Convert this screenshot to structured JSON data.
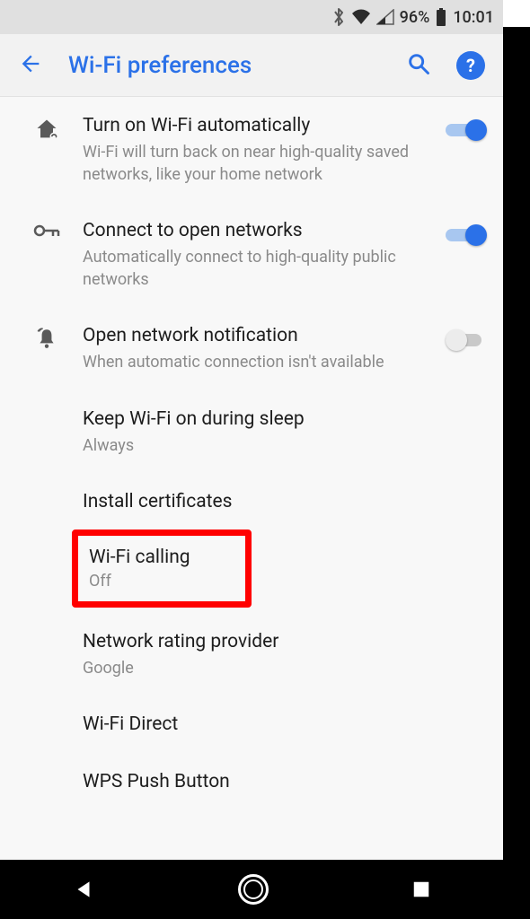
{
  "statusbar": {
    "battery_pct": "96%",
    "time": "10:01"
  },
  "appbar": {
    "title": "Wi-Fi preferences"
  },
  "settings": [
    {
      "icon": "home",
      "title": "Turn on Wi-Fi automatically",
      "subtitle": "Wi-Fi will turn back on near high-quality saved networks, like your home network",
      "toggle": "on"
    },
    {
      "icon": "key",
      "title": "Connect to open networks",
      "subtitle": "Automatically connect to high-quality public networks",
      "toggle": "on"
    },
    {
      "icon": "bell",
      "title": "Open network notification",
      "subtitle": "When automatic connection isn't available",
      "toggle": "off"
    },
    {
      "icon": "",
      "title": "Keep Wi-Fi on during sleep",
      "subtitle": "Always",
      "toggle": null
    },
    {
      "icon": "",
      "title": "Install certificates",
      "subtitle": "",
      "toggle": null
    }
  ],
  "highlighted": {
    "title": "Wi-Fi calling",
    "subtitle": "Off"
  },
  "settings2": [
    {
      "title": "Network rating provider",
      "subtitle": "Google"
    },
    {
      "title": "Wi-Fi Direct",
      "subtitle": ""
    },
    {
      "title": "WPS Push Button",
      "subtitle": ""
    }
  ]
}
